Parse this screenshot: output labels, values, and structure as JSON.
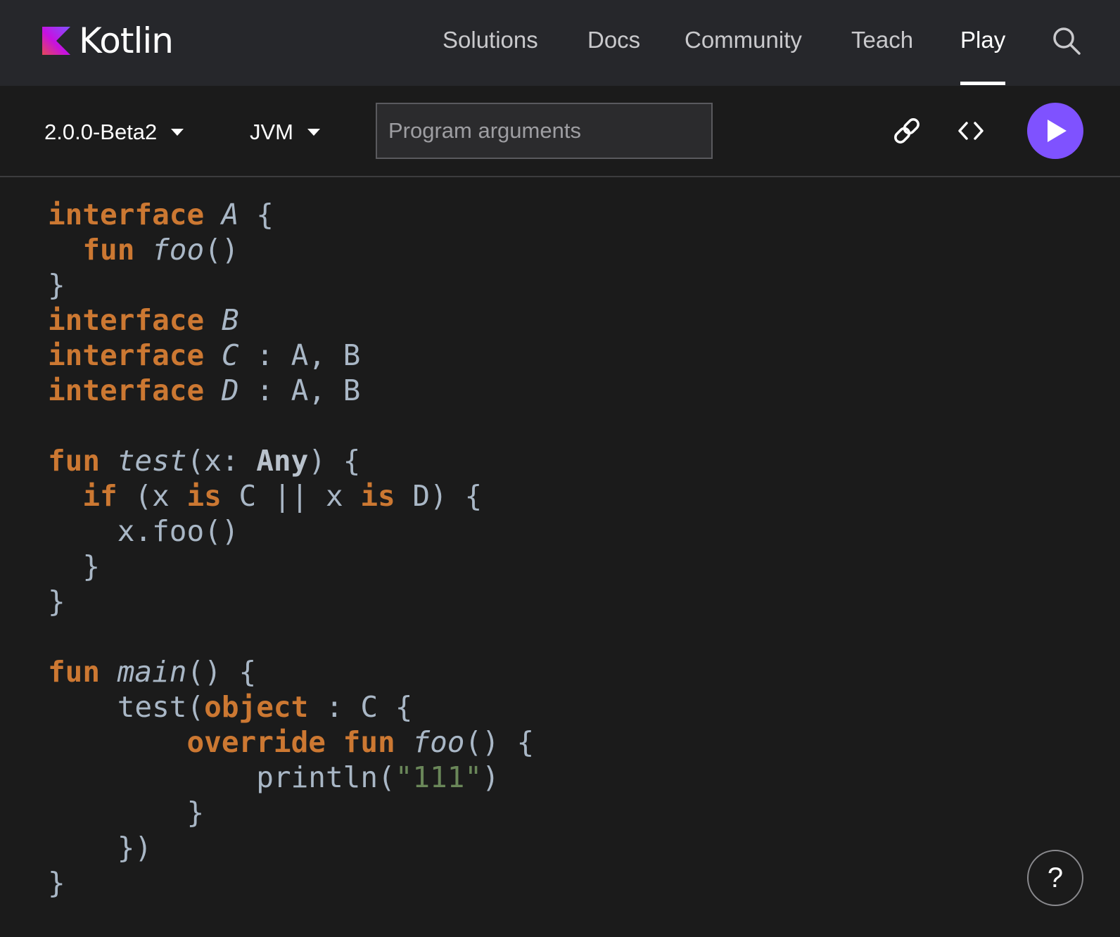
{
  "header": {
    "logo_text": "Kotlin",
    "nav": [
      {
        "label": "Solutions"
      },
      {
        "label": "Docs"
      },
      {
        "label": "Community"
      },
      {
        "label": "Teach"
      },
      {
        "label": "Play",
        "active": true
      }
    ],
    "search_icon": "search-icon"
  },
  "toolbar": {
    "version": "2.0.0-Beta2",
    "platform": "JVM",
    "args_placeholder": "Program arguments",
    "args_value": "",
    "icons": [
      "link-icon",
      "code-embed-icon",
      "play-icon"
    ]
  },
  "editor": {
    "lines": [
      [
        {
          "t": "interface",
          "c": "kw"
        },
        {
          "t": " "
        },
        {
          "t": "A",
          "c": "it"
        },
        {
          "t": " {"
        }
      ],
      [
        {
          "t": "  "
        },
        {
          "t": "fun",
          "c": "kw"
        },
        {
          "t": " "
        },
        {
          "t": "foo",
          "c": "it"
        },
        {
          "t": "()"
        }
      ],
      [
        {
          "t": "}"
        }
      ],
      [
        {
          "t": "interface",
          "c": "kw"
        },
        {
          "t": " "
        },
        {
          "t": "B",
          "c": "it"
        }
      ],
      [
        {
          "t": "interface",
          "c": "kw"
        },
        {
          "t": " "
        },
        {
          "t": "C",
          "c": "it"
        },
        {
          "t": " : A, B"
        }
      ],
      [
        {
          "t": "interface",
          "c": "kw"
        },
        {
          "t": " "
        },
        {
          "t": "D",
          "c": "it"
        },
        {
          "t": " : A, B"
        }
      ],
      [],
      [
        {
          "t": "fun",
          "c": "kw"
        },
        {
          "t": " "
        },
        {
          "t": "test",
          "c": "it"
        },
        {
          "t": "(x: "
        },
        {
          "t": "Any",
          "c": "ty"
        },
        {
          "t": ") {"
        }
      ],
      [
        {
          "t": "  "
        },
        {
          "t": "if",
          "c": "kw"
        },
        {
          "t": " (x "
        },
        {
          "t": "is",
          "c": "kw"
        },
        {
          "t": " C || x "
        },
        {
          "t": "is",
          "c": "kw"
        },
        {
          "t": " D) {"
        }
      ],
      [
        {
          "t": "    x.foo()"
        }
      ],
      [
        {
          "t": "  }"
        }
      ],
      [
        {
          "t": "}"
        }
      ],
      [],
      [
        {
          "t": "fun",
          "c": "kw"
        },
        {
          "t": " "
        },
        {
          "t": "main",
          "c": "it"
        },
        {
          "t": "() {"
        }
      ],
      [
        {
          "t": "    test("
        },
        {
          "t": "object",
          "c": "kw"
        },
        {
          "t": " : C {"
        }
      ],
      [
        {
          "t": "        "
        },
        {
          "t": "override",
          "c": "kw"
        },
        {
          "t": " "
        },
        {
          "t": "fun",
          "c": "kw"
        },
        {
          "t": " "
        },
        {
          "t": "foo",
          "c": "it"
        },
        {
          "t": "() {"
        }
      ],
      [
        {
          "t": "            println("
        },
        {
          "t": "\"111\"",
          "c": "str"
        },
        {
          "t": ")"
        }
      ],
      [
        {
          "t": "        }"
        }
      ],
      [
        {
          "t": "    })"
        }
      ],
      [
        {
          "t": "}"
        }
      ]
    ]
  },
  "help": {
    "label": "?"
  },
  "colors": {
    "accent": "#7f52ff",
    "keyword": "#cc7832",
    "string": "#6a8759",
    "code_text": "#a9b7c6",
    "background": "#1b1b1b",
    "nav_background": "#26272b"
  }
}
